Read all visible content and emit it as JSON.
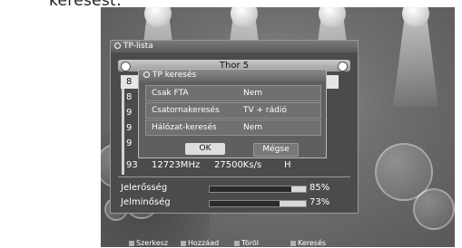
{
  "heading": "keresést:",
  "tp_list": {
    "title": "TP-lista",
    "satellite": "Thor 5",
    "rows": [
      {
        "num": "8",
        "freq": "",
        "sr": "",
        "pol": ""
      },
      {
        "num": "8",
        "freq": "",
        "sr": "",
        "pol": ""
      },
      {
        "num": "9",
        "freq": "",
        "sr": "",
        "pol": ""
      },
      {
        "num": "9",
        "freq": "",
        "sr": "",
        "pol": ""
      },
      {
        "num": "9",
        "freq": "",
        "sr": "",
        "pol": ""
      },
      {
        "num": "93",
        "freq": "12723MHz",
        "sr": "27500Ks/s",
        "pol": "H"
      }
    ],
    "signal_strength_label": "Jelerősség",
    "signal_strength_value": "85%",
    "signal_strength_level": 0.85,
    "signal_quality_label": "Jelminőség",
    "signal_quality_value": "73%",
    "signal_quality_level": 0.73
  },
  "search_dialog": {
    "title": "TP keresés",
    "options": [
      {
        "label": "Csak FTA",
        "value": "Nem"
      },
      {
        "label": "Csatornakeresés",
        "value": "TV + rádió"
      },
      {
        "label": "Hálózat-keresés",
        "value": "Nem"
      }
    ],
    "ok_label": "OK",
    "cancel_label": "Mégse"
  },
  "help_bar": {
    "edit": "Szerkesz",
    "add": "Hozzáad",
    "delete": "Töröl",
    "search": "Keresés"
  }
}
